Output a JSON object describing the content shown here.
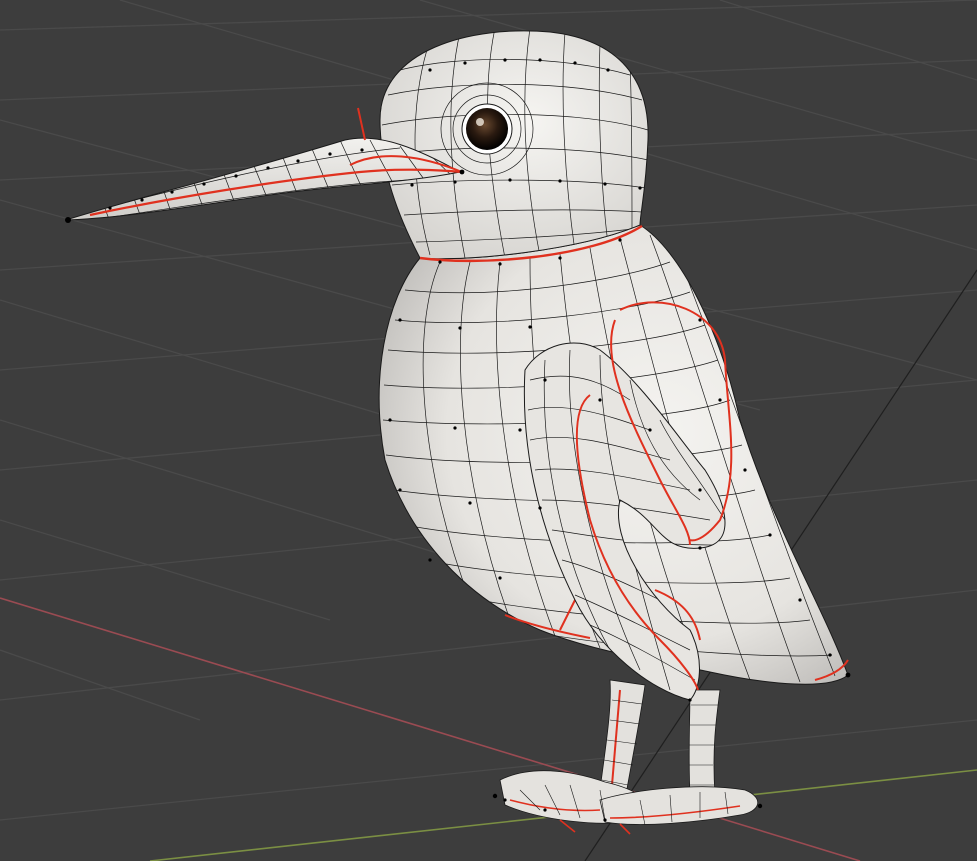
{
  "viewport": {
    "mode": "edit-mode-3d-viewport",
    "background_color": "#3d3d3d",
    "grid_color": "#4a4a4a",
    "x_axis_color": "#9a4b52",
    "y_axis_color": "#7b8f43",
    "z_axis_color": "#1f1f1f"
  },
  "mesh": {
    "object": "kingfisher-bird",
    "surface_color": "#e9e7e3",
    "wire_color": "#1a1a1a",
    "seam_color": "#e0311f",
    "vertex_color": "#000000",
    "eye_color": "#2a1a10"
  }
}
